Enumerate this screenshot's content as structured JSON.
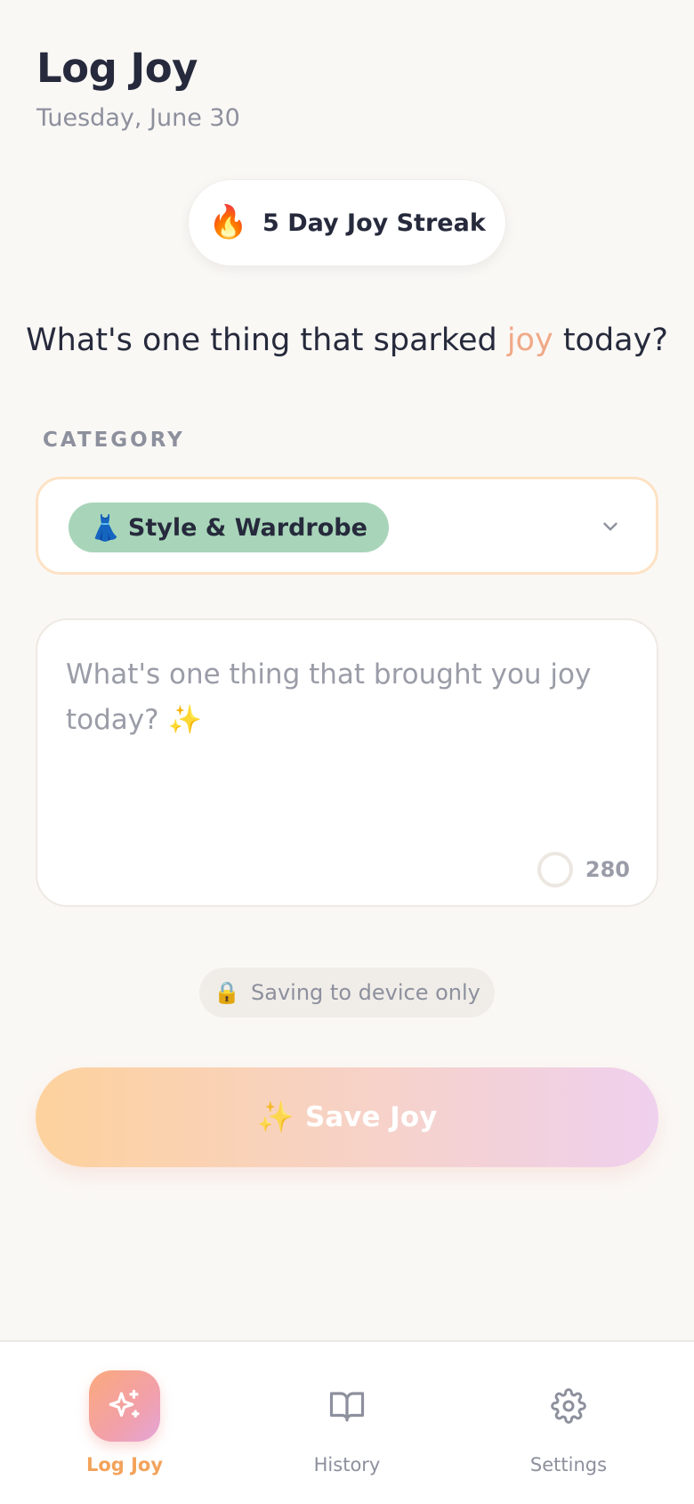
{
  "header": {
    "title": "Log Joy",
    "date": "Tuesday, June 30"
  },
  "streak": {
    "emoji": "🔥",
    "label": "5 Day Joy Streak"
  },
  "prompt": {
    "before": "What's one thing that sparked ",
    "highlight": "joy",
    "after": " today?"
  },
  "category": {
    "label": "CATEGORY",
    "selected_emoji": "👗",
    "selected_text": "Style & Wardrobe",
    "chip_color": "#a8d5b9"
  },
  "entry": {
    "placeholder": "What's one thing that brought you joy today? ✨",
    "remaining": "280"
  },
  "privacy": {
    "emoji": "🔒",
    "text": "Saving to device only"
  },
  "save_button": {
    "emoji": "✨",
    "label": "Save Joy"
  },
  "tabs": [
    {
      "label": "Log Joy",
      "icon": "sparkle-icon",
      "active": true
    },
    {
      "label": "History",
      "icon": "book-open-icon",
      "active": false
    },
    {
      "label": "Settings",
      "icon": "gear-icon",
      "active": false
    }
  ],
  "colors": {
    "accent": "#f3a35c",
    "joy_highlight": "#f0a988",
    "background": "#faf8f5"
  }
}
